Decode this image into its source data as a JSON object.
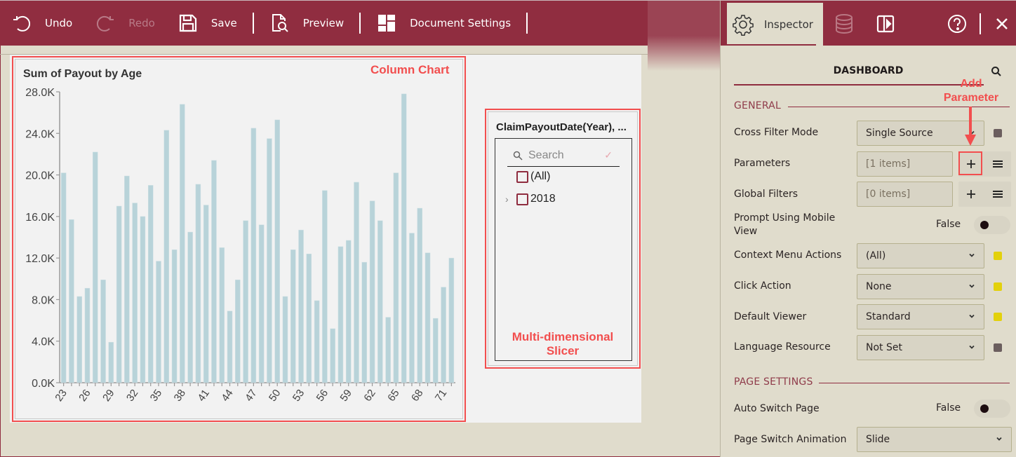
{
  "toolbar": {
    "undo_label": "Undo",
    "redo_label": "Redo",
    "save_label": "Save",
    "preview_label": "Preview",
    "document_settings_label": "Document Settings",
    "redo_enabled": false
  },
  "panel": {
    "tabs": [
      {
        "name": "Inspector",
        "icon": "gear-icon",
        "active": true
      },
      {
        "name": "Data Source",
        "icon": "database-icon",
        "active": false
      },
      {
        "name": "Layout",
        "icon": "panel-toggle-icon",
        "active": false
      }
    ],
    "inspector_label": "Inspector",
    "help_icon": "help-icon",
    "close_icon": "close-icon",
    "title": "DASHBOARD",
    "sections": {
      "general": {
        "label": "GENERAL",
        "cross_filter_mode": {
          "label": "Cross Filter Mode",
          "value": "Single Source",
          "indicator_color": "#6b5e5e"
        },
        "parameters": {
          "label": "Parameters",
          "value": "[1 items]"
        },
        "global_filters": {
          "label": "Global Filters",
          "value": "[0 items]"
        },
        "prompt_mobile": {
          "label": "Prompt Using Mobile View",
          "value": "False",
          "checked": false
        },
        "context_menu_actions": {
          "label": "Context Menu Actions",
          "value": "(All)",
          "indicator_color": "#e3d10c"
        },
        "click_action": {
          "label": "Click Action",
          "value": "None",
          "indicator_color": "#e3d10c"
        },
        "default_viewer": {
          "label": "Default Viewer",
          "value": "Standard",
          "indicator_color": "#e3d10c"
        },
        "language_resource": {
          "label": "Language Resource",
          "value": "Not Set",
          "indicator_color": "#6b5e5e"
        }
      },
      "page_settings": {
        "label": "PAGE SETTINGS",
        "auto_switch_page": {
          "label": "Auto Switch Page",
          "value": "False",
          "checked": false
        },
        "page_switch_animation": {
          "label": "Page Switch Animation",
          "value": "Slide"
        }
      }
    }
  },
  "annotations": {
    "column_chart": "Column Chart",
    "slicer": "Multi-dimensional Slicer",
    "add_parameter_line1": "Add",
    "add_parameter_line2": "Parameter"
  },
  "slicer": {
    "title": "ClaimPayoutDate(Year), ...",
    "search_placeholder": "Search",
    "items": [
      {
        "label": "(All)",
        "expandable": false,
        "checked": false
      },
      {
        "label": "2018",
        "expandable": true,
        "checked": false
      }
    ]
  },
  "colors": {
    "brand": "#902d40",
    "bar": "#b8d3d9",
    "annotation": "#f24e4e",
    "panel_bg": "#e0dccc"
  },
  "chart_data": {
    "type": "bar",
    "title": "Sum of Payout by Age",
    "xlabel": "",
    "ylabel": "",
    "ylim": [
      0,
      28000
    ],
    "yticks": [
      0,
      4000,
      8000,
      12000,
      16000,
      20000,
      24000,
      28000
    ],
    "ytick_labels": [
      "0.0K",
      "4.0K",
      "8.0K",
      "12.0K",
      "16.0K",
      "20.0K",
      "24.0K",
      "28.0K"
    ],
    "xtick_labels_shown": [
      "23",
      "26",
      "29",
      "32",
      "35",
      "38",
      "41",
      "44",
      "47",
      "50",
      "53",
      "56",
      "59",
      "62",
      "65",
      "68",
      "71"
    ],
    "categories": [
      "23",
      "24",
      "25",
      "26",
      "27",
      "28",
      "29",
      "30",
      "31",
      "32",
      "33",
      "34",
      "35",
      "36",
      "37",
      "38",
      "39",
      "40",
      "41",
      "42",
      "43",
      "44",
      "45",
      "46",
      "47",
      "48",
      "49",
      "50",
      "51",
      "52",
      "53",
      "54",
      "55",
      "56",
      "57",
      "58",
      "59",
      "60",
      "61",
      "62",
      "63",
      "64",
      "65",
      "66",
      "67",
      "68",
      "69",
      "70",
      "71",
      "72"
    ],
    "values": [
      20200,
      15700,
      8300,
      9100,
      22200,
      9900,
      3900,
      17000,
      19900,
      17300,
      16000,
      19000,
      11700,
      24300,
      12800,
      26800,
      14500,
      19100,
      17100,
      21400,
      13000,
      6900,
      9900,
      15600,
      24500,
      15200,
      23500,
      25300,
      8300,
      12800,
      14700,
      12400,
      7900,
      18500,
      5200,
      13100,
      13700,
      19300,
      11600,
      17500,
      15600,
      6300,
      20200,
      27800,
      14400,
      16800,
      12500,
      6200,
      9200,
      12000
    ],
    "grid": false,
    "legend": "none"
  }
}
